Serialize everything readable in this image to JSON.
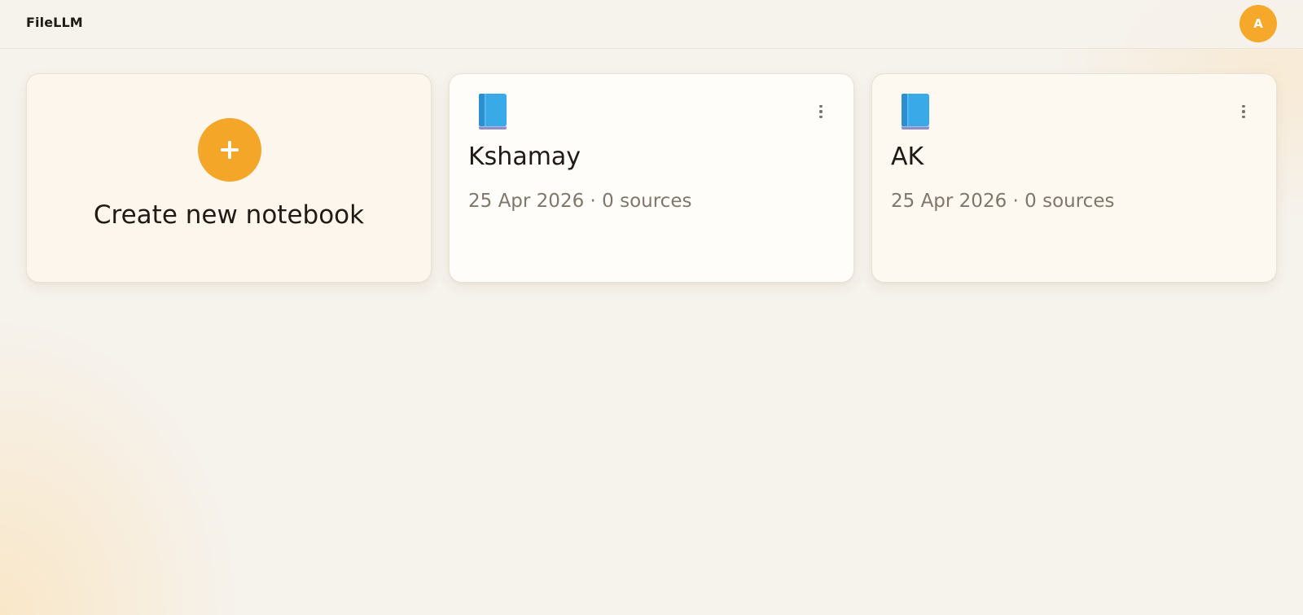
{
  "app": {
    "brand": "FileLLM",
    "user_initial": "A"
  },
  "create_card": {
    "label": "Create new notebook",
    "icon": "plus-icon"
  },
  "notebooks": [
    {
      "icon": "blue-book-icon",
      "title": "Kshamay",
      "date": "25 Apr 2026",
      "separator": "·",
      "sources": "0 sources",
      "meta": "25 Apr 2026 · 0 sources"
    },
    {
      "icon": "blue-book-icon",
      "title": "AK",
      "date": "25 Apr 2026",
      "separator": "·",
      "sources": "0 sources",
      "meta": "25 Apr 2026 · 0 sources"
    }
  ],
  "colors": {
    "accent": "#f4a628",
    "background": "#f6f2ec",
    "text": "#1f1a15",
    "muted": "#7f766c",
    "book": "#3aa9e8"
  }
}
